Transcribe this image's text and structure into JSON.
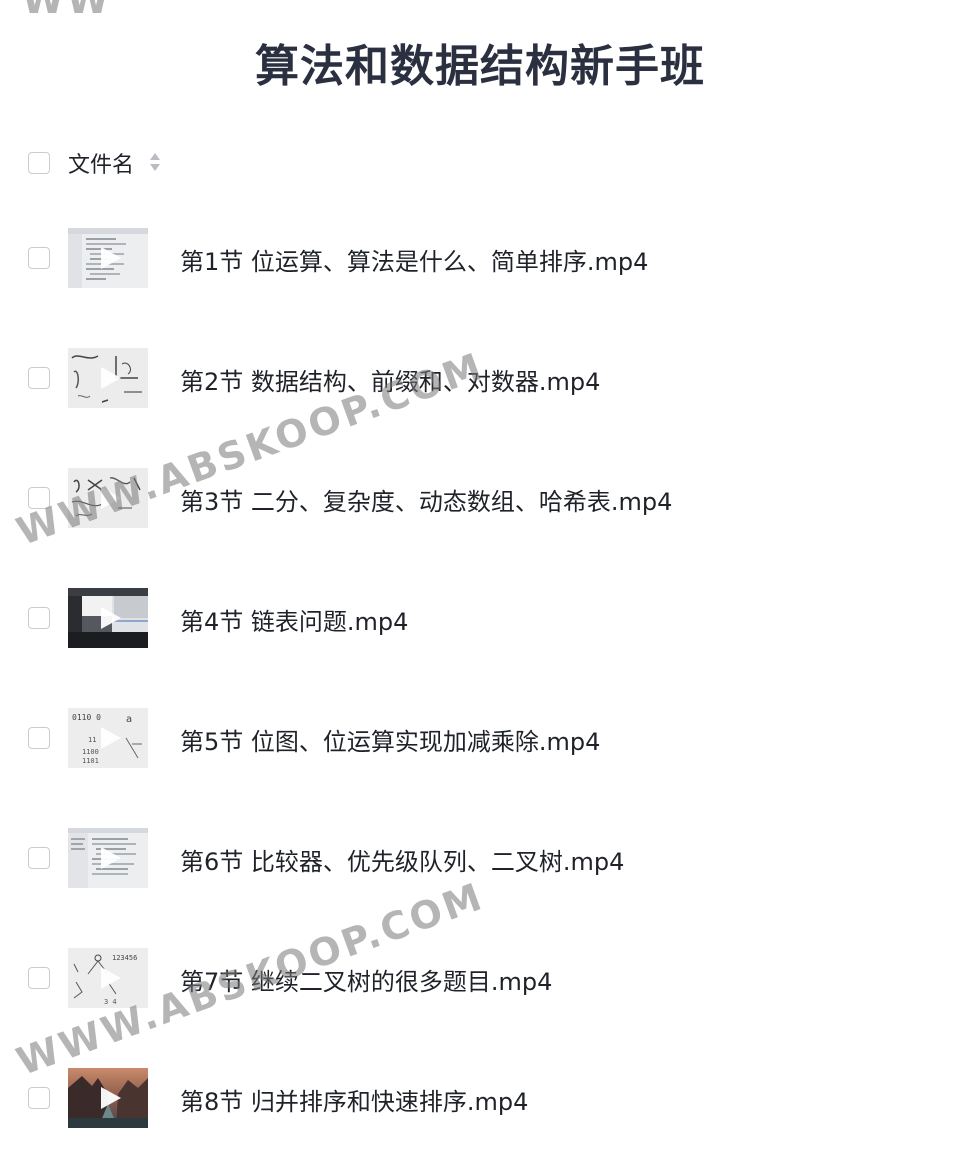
{
  "page": {
    "title": "算法和数据结构新手班"
  },
  "list_header": {
    "column_label": "文件名",
    "sort_icon": "sort-updown-icon"
  },
  "files": [
    {
      "name": "第1节 位运算、算法是什么、简单排序.mp4",
      "thumbnail": "code-screenshot"
    },
    {
      "name": "第2节 数据结构、前缀和、对数器.mp4",
      "thumbnail": "whiteboard-sketch"
    },
    {
      "name": "第3节 二分、复杂度、动态数组、哈希表.mp4",
      "thumbnail": "whiteboard-sketch"
    },
    {
      "name": "第4节 链表问题.mp4",
      "thumbnail": "dark-desktop"
    },
    {
      "name": "第5节 位图、位运算实现加减乘除.mp4",
      "thumbnail": "whiteboard-sketch"
    },
    {
      "name": "第6节 比较器、优先级队列、二叉树.mp4",
      "thumbnail": "code-screenshot"
    },
    {
      "name": "第7节 继续二叉树的很多题目.mp4",
      "thumbnail": "whiteboard-sketch"
    },
    {
      "name": "第8节 归并排序和快速排序.mp4",
      "thumbnail": "landscape-photo"
    }
  ],
  "watermark": {
    "text": "WWW.ABSKOOP.COM",
    "top_fragment": "WW"
  },
  "colors": {
    "title": "#2b3040",
    "text": "#1f2329",
    "checkbox_border": "#c9ccd2",
    "watermark": "#787878"
  }
}
